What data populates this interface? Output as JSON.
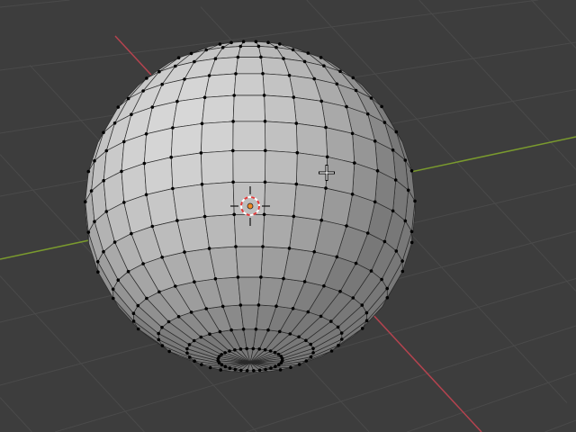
{
  "viewport": {
    "background_color": "#3d3d3d",
    "grid_color": "#4a4a4a",
    "x_axis_color": "#b4434f",
    "y_axis_color": "#7a9a2e",
    "mesh_face_color": "#a9a9a9",
    "mesh_edge_color": "#2a2a2a",
    "mesh_vertex_color": "#000000",
    "cursor_3d_colors": [
      "#e03a3a",
      "#ffffff"
    ],
    "origin_color": "#f08a24"
  }
}
